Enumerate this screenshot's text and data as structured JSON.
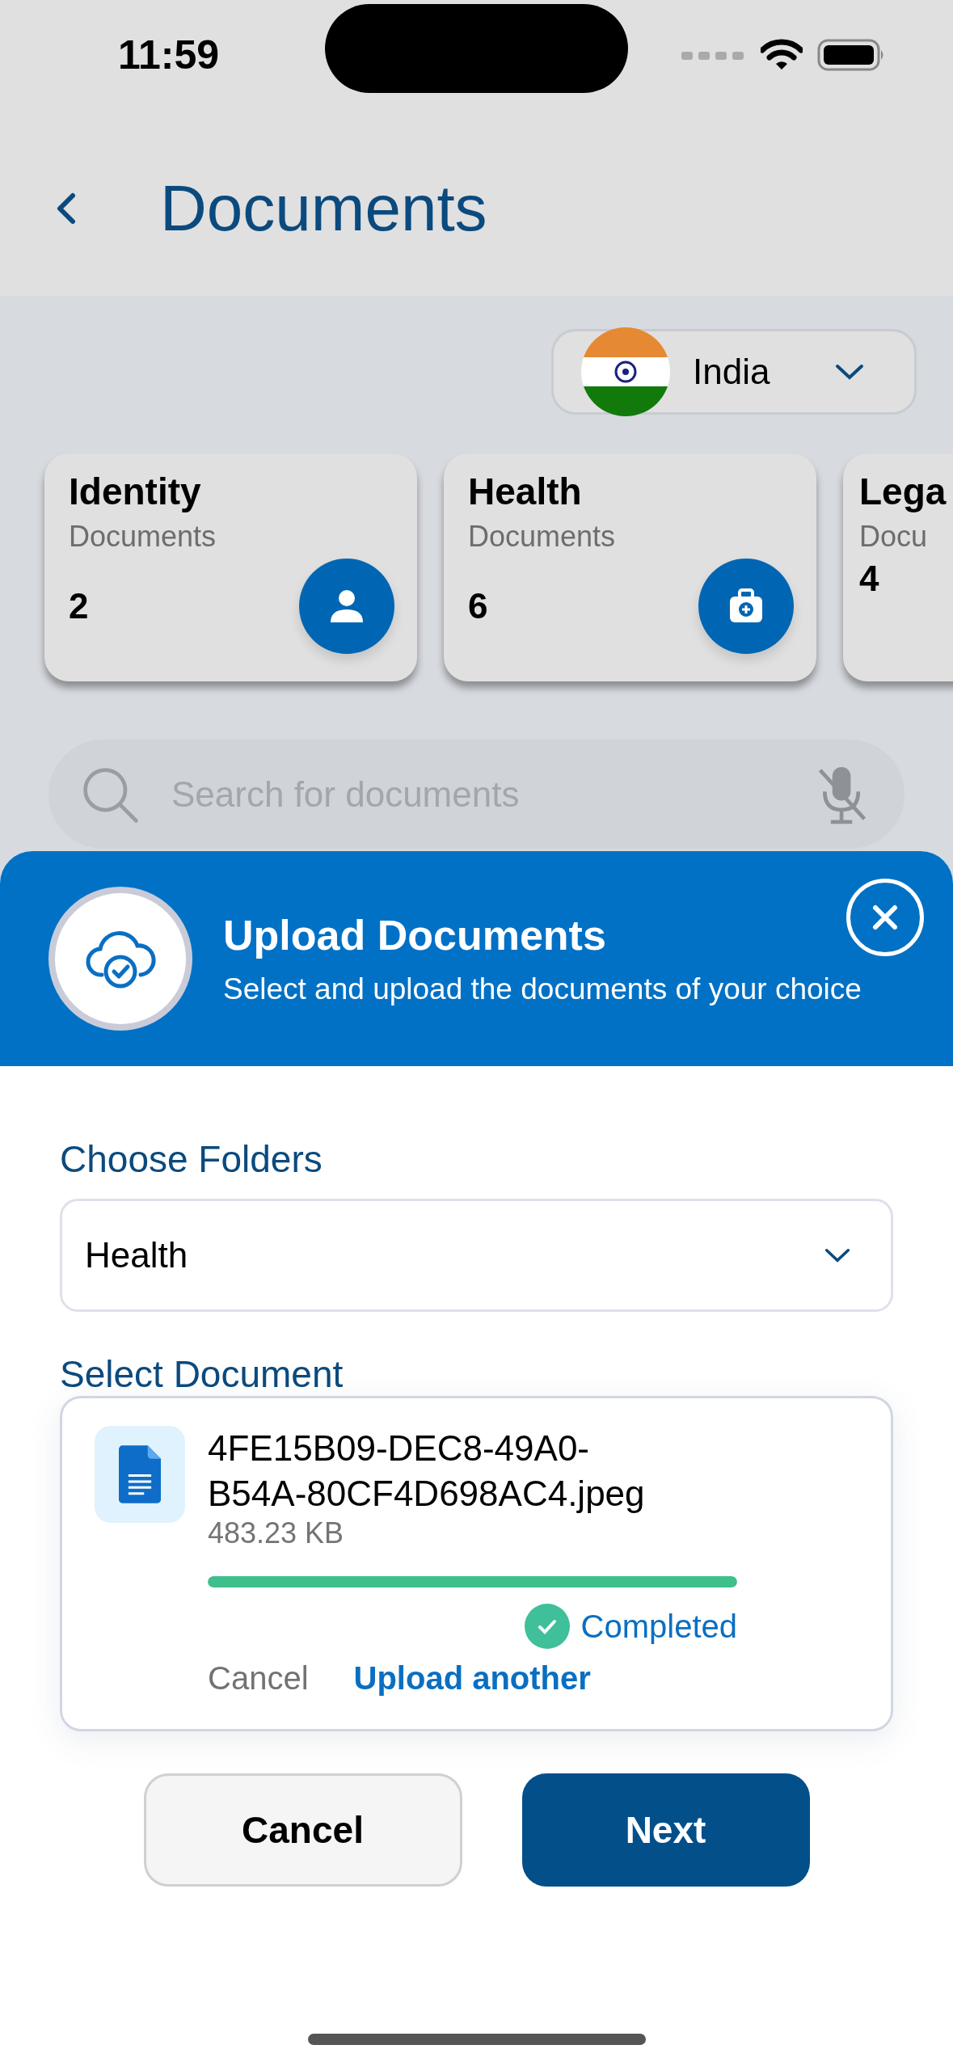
{
  "status_bar": {
    "time": "11:59"
  },
  "header": {
    "title": "Documents"
  },
  "country_select": {
    "value": "India"
  },
  "categories": [
    {
      "title": "Identity",
      "subtitle": "Documents",
      "count": "2",
      "kind": "identity"
    },
    {
      "title": "Health",
      "subtitle": "Documents",
      "count": "6",
      "kind": "health"
    },
    {
      "title": "Lega",
      "subtitle": "Docu",
      "count": "4",
      "kind": "partial"
    }
  ],
  "search": {
    "placeholder": "Search for documents"
  },
  "upload_sheet": {
    "title": "Upload Documents",
    "subtitle": "Select and upload the documents of your choice",
    "folder_label": "Choose Folders",
    "folder_value": "Health",
    "document_label": "Select Document",
    "file": {
      "name": "4FE15B09-DEC8-49A0-B54A-80CF4D698AC4.jpeg",
      "size": "483.23 KB",
      "level": 1,
      "status": "Completed",
      "cancel": "Cancel",
      "upload_another": "Upload another"
    },
    "buttons": [
      {
        "label": "Cancel",
        "kind": "secondary"
      },
      {
        "label": "Next",
        "kind": "primary"
      }
    ]
  }
}
